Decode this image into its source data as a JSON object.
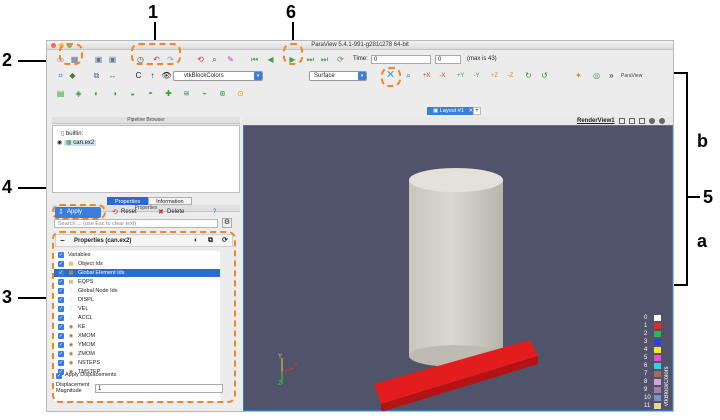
{
  "window": {
    "title": "ParaView 5.4.1-991-g281c278 64-bit"
  },
  "toolbar_main": {
    "time_label": "Time:",
    "time_value": "0",
    "time_index": "0",
    "max_label": "(max is 43)"
  },
  "toolbar_second": {
    "coloring": "vtkBlockColors",
    "representation": "Surface",
    "more_label": "»",
    "extra_label": "ParaView"
  },
  "pipeline_browser": {
    "header": "Pipeline Browser",
    "items": [
      {
        "label": "builtin:"
      },
      {
        "label": "can.ex2"
      }
    ]
  },
  "tabs": [
    "Properties",
    "Information"
  ],
  "properties": {
    "header": "Properties",
    "apply": "Apply",
    "reset": "Reset",
    "delete": "Delete",
    "help": "?",
    "search_placeholder": "Search ... (use Esc to clear text)",
    "section_title": "Properties (can.ex2)",
    "variables_label": "Variables",
    "variables": [
      {
        "label": "Object Ids",
        "icon": "cell-icon",
        "selected": false
      },
      {
        "label": "Global Element Ids",
        "icon": "cell-icon",
        "selected": true
      },
      {
        "label": "EQPS",
        "icon": "cell-icon",
        "selected": false
      },
      {
        "label": "Global Node Ids",
        "icon": "point-icon",
        "selected": false
      },
      {
        "label": "DISPL",
        "icon": "point-icon",
        "selected": false
      },
      {
        "label": "VEL",
        "icon": "point-icon",
        "selected": false
      },
      {
        "label": "ACCL",
        "icon": "point-icon",
        "selected": false
      },
      {
        "label": "KE",
        "icon": "global-icon",
        "selected": false
      },
      {
        "label": "XMOM",
        "icon": "global-icon",
        "selected": false
      },
      {
        "label": "YMOM",
        "icon": "global-icon",
        "selected": false
      },
      {
        "label": "ZMOM",
        "icon": "global-icon",
        "selected": false
      },
      {
        "label": "NSTEPS",
        "icon": "global-icon",
        "selected": false
      },
      {
        "label": "TMSTEP",
        "icon": "global-icon",
        "selected": false
      }
    ],
    "apply_displacements": "Apply Displacements",
    "displacement_magnitude_label": "Displacement Magnitude",
    "displacement_magnitude_value": "1"
  },
  "view": {
    "layout_tab": "Layout #1",
    "render_view_label": "RenderView1",
    "legend_title": "vtkBlockColors",
    "legend_entries": [
      "0",
      "1",
      "2",
      "3",
      "4",
      "5",
      "6",
      "7",
      "8",
      "9",
      "10",
      "11"
    ],
    "legend_colors": [
      "#ffffff",
      "#e8262b",
      "#35b34a",
      "#2f3fd6",
      "#f3ea1e",
      "#e34fd6",
      "#2fd3e6",
      "#a56b5a",
      "#d8a2d8",
      "#b07aa6",
      "#7c90c8",
      "#f0d38b"
    ],
    "axis_y": "Y",
    "axis_x": "X",
    "axis_z": "Z"
  },
  "annotations": {
    "labels": [
      "1",
      "6",
      "2",
      "b",
      "4",
      "5",
      "3",
      "a"
    ],
    "color": "#ee8526"
  }
}
